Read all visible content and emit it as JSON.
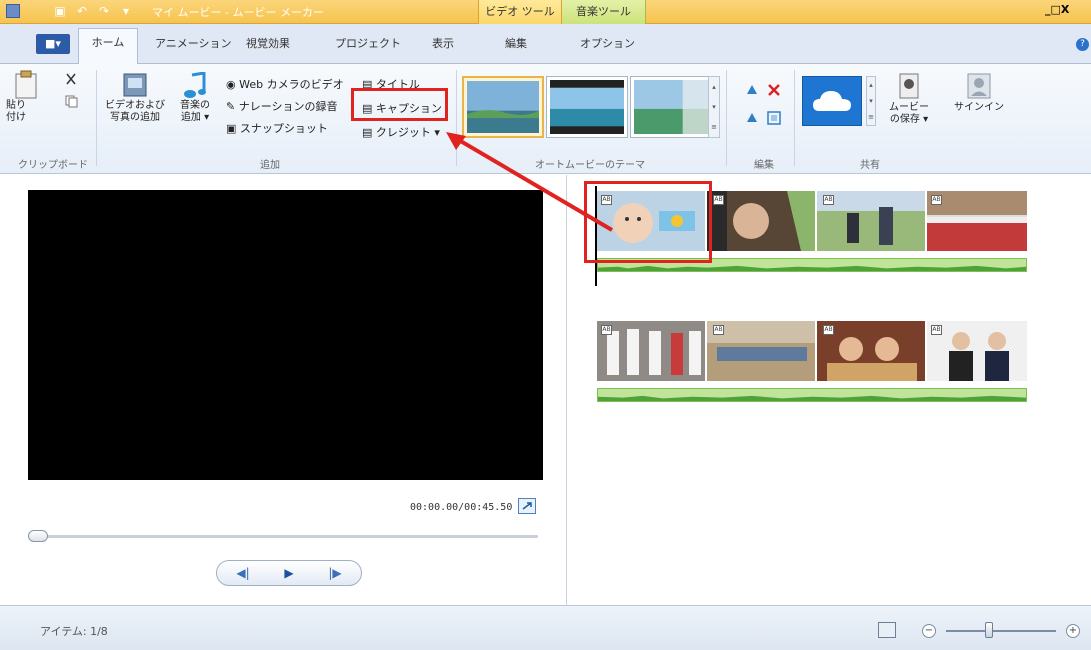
{
  "window": {
    "title": "マイ ムービー - ムービー メーカー",
    "context_tab_video": "ビデオ ツール",
    "context_tab_music": "音楽ツール",
    "window_controls": "_□X"
  },
  "tabs": {
    "file": "■▾",
    "home": "ホーム",
    "animations": "アニメーション",
    "visual_effects": "視覚効果",
    "project": "プロジェクト",
    "view": "表示",
    "edit": "編集",
    "options": "オプション"
  },
  "ribbon": {
    "clipboard": {
      "paste": "貼り\n付け",
      "label": "クリップボード"
    },
    "add": {
      "add_videos_photos": "ビデオおよび\n写真の追加",
      "add_music": "音楽の\n追加 ▾",
      "webcam_video": "Web カメラのビデオ",
      "record_narration": "ナレーションの録音",
      "snapshot": "スナップショット",
      "title": "タイトル",
      "caption": "キャプション",
      "credits": "クレジット ▾",
      "label": "追加"
    },
    "themes": {
      "label": "オートムービーのテーマ"
    },
    "editing": {
      "label": "編集"
    },
    "share": {
      "save_movie": "ムービー\nの保存 ▾",
      "sign_in": "サインイン",
      "label": "共有"
    }
  },
  "preview": {
    "timecode": "00:00.00/00:45.50"
  },
  "status": {
    "items": "アイテム: 1/8"
  },
  "colors": {
    "highlight_red": "#e0231f",
    "title_bar": "#f6c44e",
    "audio_green": "#7fbf4e"
  }
}
